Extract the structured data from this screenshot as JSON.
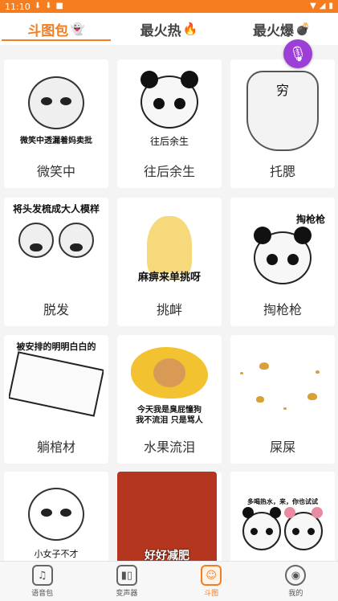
{
  "status": {
    "time": "11:10",
    "left_icons": [
      "download-icon",
      "download-icon",
      "square-icon"
    ]
  },
  "tabs": [
    {
      "label": "斗图包",
      "emoji": "👻",
      "active": true
    },
    {
      "label": "最火热",
      "emoji": "🔥",
      "active": false
    },
    {
      "label": "最火爆",
      "emoji": "💣",
      "active": false
    }
  ],
  "floating_button": {
    "icon": "microphone-icon"
  },
  "cards": [
    {
      "caption": "微笑中",
      "image_text": "微笑中透漏着妈卖批"
    },
    {
      "caption": "往后余生",
      "image_text": "往后余生"
    },
    {
      "caption": "托腮",
      "image_text": "穷"
    },
    {
      "caption": "脱发",
      "image_text": "将头发梳成大人模样"
    },
    {
      "caption": "挑衅",
      "image_text": "麻痹来单挑呀"
    },
    {
      "caption": "掏枪枪",
      "image_text": "掏枪枪"
    },
    {
      "caption": "躺棺材",
      "image_text": "被安排的明明白白的"
    },
    {
      "caption": "水果流泪",
      "image_text": "今天我是臭屁憧狗\n我不流泪 只是骂人"
    },
    {
      "caption": "屎屎",
      "image_text": ""
    },
    {
      "caption": "",
      "image_text": "小女子不才"
    },
    {
      "caption": "",
      "image_text": "好好减肥"
    },
    {
      "caption": "",
      "image_text": "多喝热水，来，你也试试"
    }
  ],
  "bottom_nav": [
    {
      "label": "语音包",
      "icon": "music-note-icon",
      "active": false
    },
    {
      "label": "变声器",
      "icon": "waveform-icon",
      "active": false
    },
    {
      "label": "斗图",
      "icon": "face-icon",
      "active": true
    },
    {
      "label": "我的",
      "icon": "person-icon",
      "active": false
    }
  ]
}
